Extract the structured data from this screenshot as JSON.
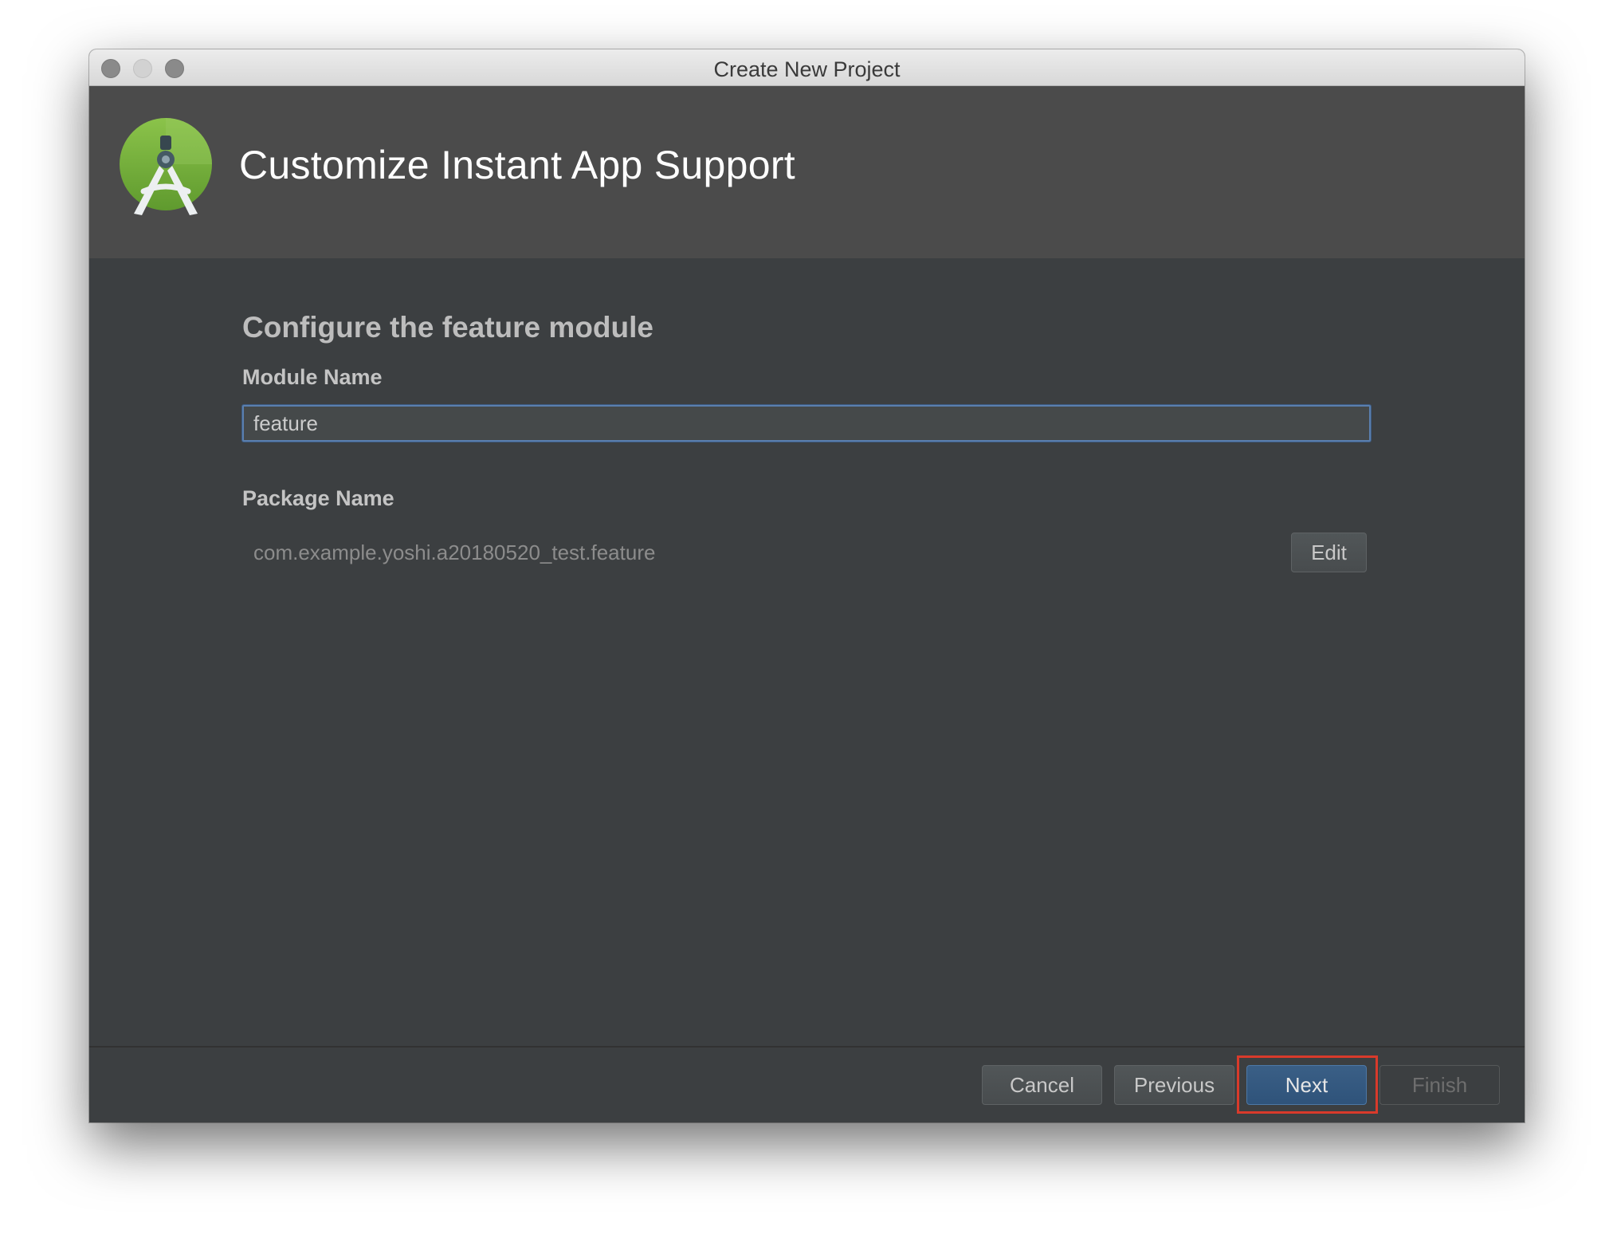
{
  "window": {
    "title": "Create New Project"
  },
  "header": {
    "title": "Customize Instant App Support",
    "logo_icon": "android-studio-logo-icon"
  },
  "form": {
    "section_title": "Configure the feature module",
    "module_name_label": "Module Name",
    "module_name_value": "feature",
    "package_name_label": "Package Name",
    "package_name_value": "com.example.yoshi.a20180520_test.feature",
    "edit_label": "Edit"
  },
  "footer": {
    "cancel_label": "Cancel",
    "previous_label": "Previous",
    "next_label": "Next",
    "finish_label": "Finish"
  },
  "colors": {
    "background": "#3c3f41",
    "header": "#4b4b4b",
    "accent": "#2f537a",
    "highlight": "#d93a2b",
    "logo_green": "#7cb342"
  }
}
